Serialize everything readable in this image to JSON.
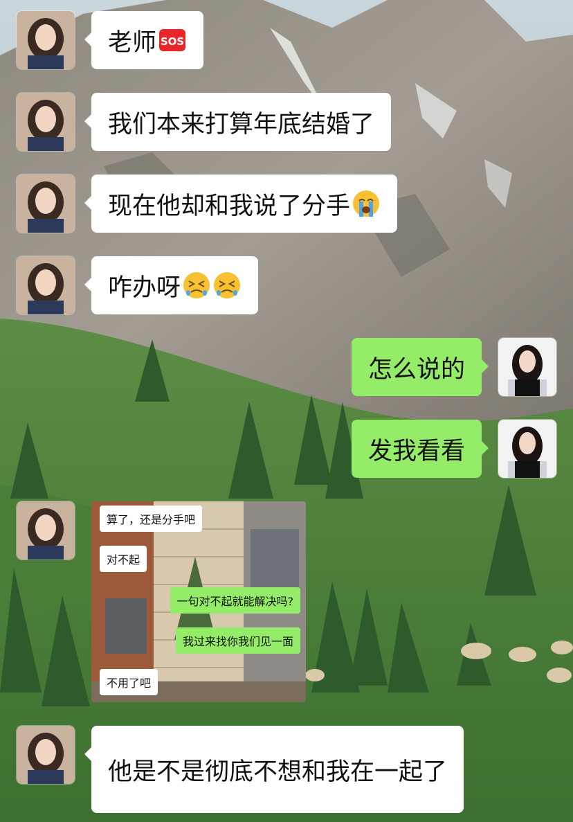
{
  "chat": {
    "messages": [
      {
        "side": "left",
        "text": "老师",
        "emoji": "sos-icon"
      },
      {
        "side": "left",
        "text": "我们本来打算年底结婚了"
      },
      {
        "side": "left",
        "text": "现在他却和我说了分手",
        "emoji": "loudly-crying-face-icon"
      },
      {
        "side": "left",
        "text": "咋办呀",
        "emoji": "tired-face-icon"
      },
      {
        "side": "right",
        "text": "怎么说的"
      },
      {
        "side": "right",
        "text": "发我看看"
      },
      {
        "side": "left",
        "type": "image"
      },
      {
        "side": "left",
        "text": "他是不是彻底不想和我在一起了"
      }
    ],
    "screenshot": {
      "messages": [
        {
          "side": "left",
          "text": "算了，还是分手吧"
        },
        {
          "side": "left",
          "text": "对不起"
        },
        {
          "side": "right",
          "text": "一句对不起就能解决吗?"
        },
        {
          "side": "right",
          "text": "我过来找你我们见一面"
        },
        {
          "side": "left",
          "text": "不用了吧"
        }
      ]
    }
  },
  "colors": {
    "outgoing_bubble": "#95ec69",
    "incoming_bubble": "#ffffff",
    "sos_red": "#e8262a"
  }
}
